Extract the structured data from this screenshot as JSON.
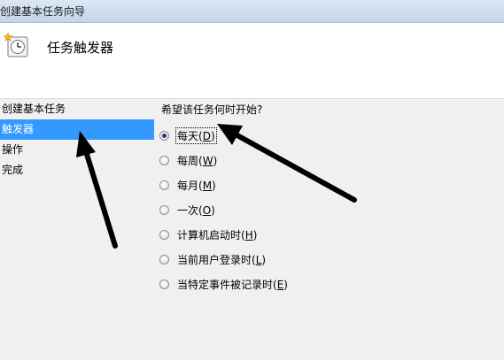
{
  "window": {
    "title": "创建基本任务向导"
  },
  "header": {
    "icon": "task-clock-icon",
    "heading": "任务触发器"
  },
  "sidebar": {
    "items": [
      {
        "label": "创建基本任务",
        "active": false
      },
      {
        "label": "触发器",
        "active": true
      },
      {
        "label": "操作",
        "active": false
      },
      {
        "label": "完成",
        "active": false
      }
    ]
  },
  "main": {
    "question": "希望该任务何时开始?",
    "options": [
      {
        "text": "每天(",
        "key": "D",
        "close": ")",
        "checked": true
      },
      {
        "text": "每周(",
        "key": "W",
        "close": ")",
        "checked": false
      },
      {
        "text": "每月(",
        "key": "M",
        "close": ")",
        "checked": false
      },
      {
        "text": "一次(",
        "key": "O",
        "close": ")",
        "checked": false
      },
      {
        "text": "计算机启动时(",
        "key": "H",
        "close": ")",
        "checked": false
      },
      {
        "text": "当前用户登录时(",
        "key": "L",
        "close": ")",
        "checked": false
      },
      {
        "text": "当特定事件被记录时(",
        "key": "E",
        "close": ")",
        "checked": false
      }
    ]
  },
  "colors": {
    "selection": "#3399ff",
    "annotation_arrow": "#000000"
  }
}
